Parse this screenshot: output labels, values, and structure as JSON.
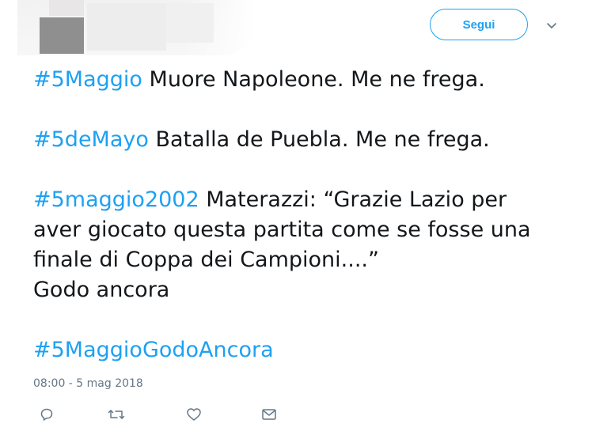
{
  "header": {
    "follow_label": "Segui",
    "menu_icon": "chevron-down-icon"
  },
  "tweet": {
    "paragraphs": [
      {
        "hashtag": "#5Maggio",
        "lines": [
          " Muore Napoleone. Me ne frega."
        ]
      },
      {
        "hashtag": "#5deMayo",
        "lines": [
          " Batalla de Puebla. Me ne frega."
        ]
      },
      {
        "hashtag": "#5maggio2002",
        "first_line": " Materazzi: “Grazie Lazio per",
        "lines": [
          "aver giocato questa partita come se fosse una",
          "finale di Coppa dei Campioni....”",
          "Godo ancora"
        ]
      },
      {
        "hashtag": "#5MaggioGodoAncora"
      }
    ],
    "timestamp": "08:00 - 5 mag 2018"
  },
  "actions": {
    "reply_icon": "reply-icon",
    "retweet_icon": "retweet-icon",
    "like_icon": "heart-icon",
    "dm_icon": "envelope-icon"
  },
  "colors": {
    "accent": "#1da1f2",
    "text": "#14171a",
    "muted": "#657786"
  }
}
